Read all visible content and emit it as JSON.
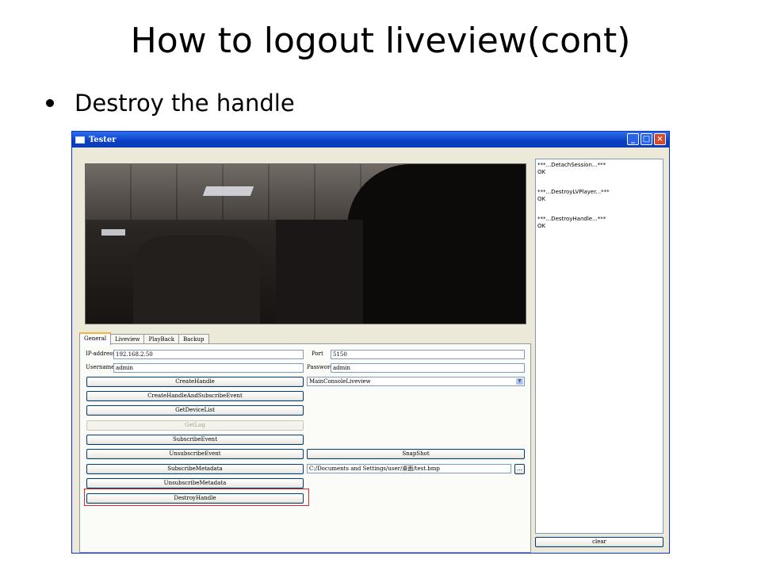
{
  "slide": {
    "title": "How to logout liveview(cont)",
    "bullets": [
      "Destroy the handle"
    ]
  },
  "window": {
    "title": "Tester",
    "controls": {
      "minimize": "_",
      "maximize": "□",
      "close": "×"
    }
  },
  "log": {
    "lines": [
      "***...DetachSession...***",
      "OK",
      "***...DestroyLVPlayer...***",
      "OK",
      "***...DestroyHandle...***",
      "OK"
    ],
    "clear_label": "clear"
  },
  "tabs": [
    {
      "label": "General",
      "active": true
    },
    {
      "label": "Liveview",
      "active": false
    },
    {
      "label": "PlayBack",
      "active": false
    },
    {
      "label": "Backup",
      "active": false
    }
  ],
  "form": {
    "ip_label": "IP-address",
    "ip_value": "192.168.2.50",
    "port_label": "Port",
    "port_value": "5150",
    "username_label": "Username",
    "username_value": "admin",
    "password_label": "Password",
    "password_value": "admin",
    "mode_selected": "MainConsoleLiveview",
    "snapshot_path": "C:/Documents and Settings/user/桌面/test.bmp",
    "browse_label": "...",
    "snapshot_label": "SnapShot"
  },
  "buttons": [
    {
      "label": "CreateHandle",
      "enabled": true
    },
    {
      "label": "CreateHandleAndSubscribeEvent",
      "enabled": true
    },
    {
      "label": "GetDeviceList",
      "enabled": true
    },
    {
      "label": "GetLog",
      "enabled": false
    },
    {
      "label": "SubscribeEvent",
      "enabled": true
    },
    {
      "label": "UnsubscribeEvent",
      "enabled": true
    },
    {
      "label": "SubscribeMetadata",
      "enabled": true
    },
    {
      "label": "UnsubscribeMetadata",
      "enabled": true
    },
    {
      "label": "DestroyHandle",
      "enabled": true
    }
  ],
  "highlight_color": "#e1262b",
  "titlebar_color": "#0a3fc4"
}
